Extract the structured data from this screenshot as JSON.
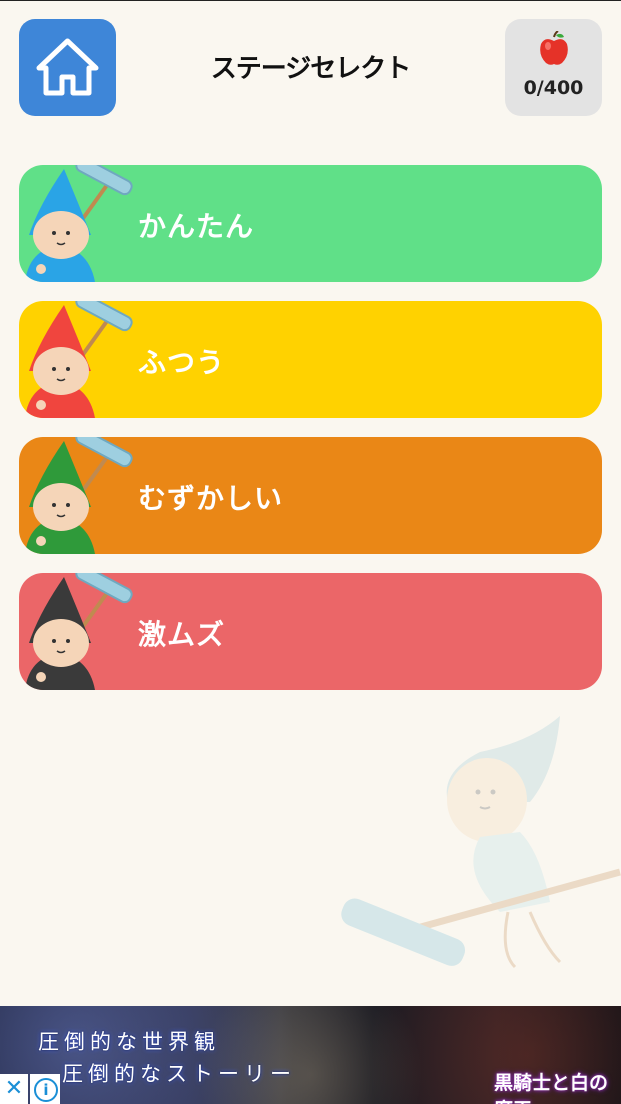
{
  "header": {
    "home_icon": "home-icon",
    "title": "ステージセレクト",
    "score_icon": "apple-icon",
    "score_text": "0/400"
  },
  "levels": [
    {
      "label": "かんたん",
      "bg": "#60e088",
      "hood": "#2aa4e6"
    },
    {
      "label": "ふつう",
      "bg": "#ffd200",
      "hood": "#f0453e"
    },
    {
      "label": "むずかしい",
      "bg": "#ea8716",
      "hood": "#2f9a3a"
    },
    {
      "label": "激ムズ",
      "bg": "#eb6668",
      "hood": "#3a3a3a"
    }
  ],
  "ad": {
    "line1": "圧倒的な世界観",
    "line2": "圧倒的なストーリー",
    "logo": "黒騎士と白の魔王",
    "close_icon": "close-icon",
    "info_icon": "info-icon"
  }
}
